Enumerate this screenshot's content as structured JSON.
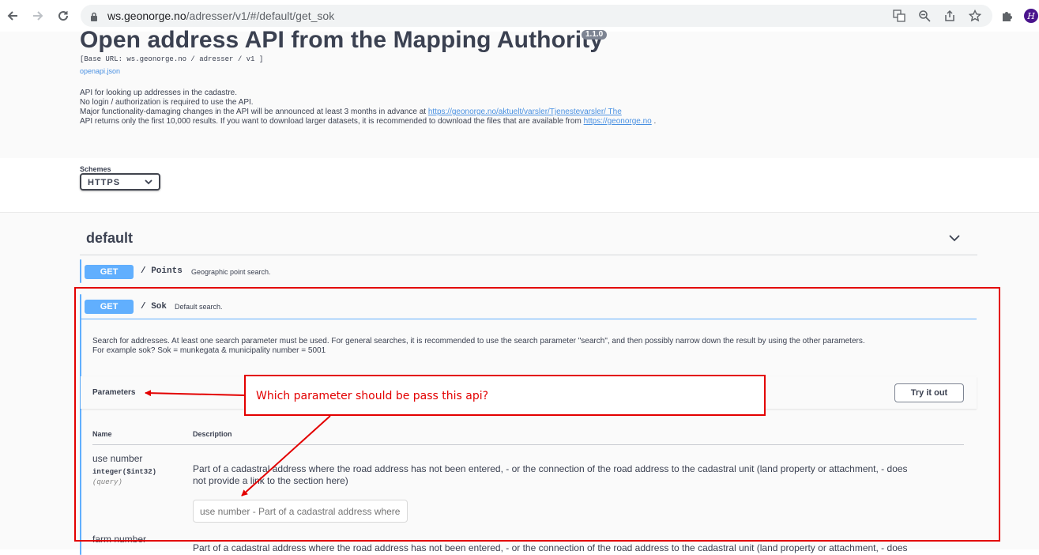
{
  "browser": {
    "url_host": "ws.geonorge.no",
    "url_path": "/adresser/v1/#/default/get_sok"
  },
  "info": {
    "title": "Open address API from the Mapping Authority",
    "version": "1.1.0",
    "base_url": "[Base URL: ws.geonorge.no / adresser / v1 ]",
    "openapi_link": "openapi.json",
    "desc_line1": "API for looking up addresses in the cadastre.",
    "desc_line2": "No login / authorization is required to use the API.",
    "desc_line3_text": "Major functionality-damaging changes in the API will be announced at least 3 months in advance at ",
    "desc_line3_link": "https://geonorge.no/aktuelt/varsler/Tjenestevarsler/ The",
    "desc_line4_text": "API returns only the first 10,000 results. If you want to download larger datasets, it is recommended to download the files that are available from ",
    "desc_line4_link": "https://geonorge.no",
    "desc_line4_end": " ."
  },
  "schemes": {
    "label": "Schemes",
    "selected": "HTTPS"
  },
  "tag": {
    "name": "default"
  },
  "operations": [
    {
      "method": "GET",
      "path": "/ Points",
      "summary": "Geographic point search."
    },
    {
      "method": "GET",
      "path": "/ Sok",
      "summary": "Default search."
    }
  ],
  "sok": {
    "desc_line1": "Search for addresses. At least one search parameter must be used. For general searches, it is recommended to use the search parameter \"search\", and then possibly narrow down the result by using the other parameters.",
    "desc_line2": "For example sok? Sok = munkegata & municipality number = 5001",
    "parameters_label": "Parameters",
    "try_button": "Try it out",
    "col_name": "Name",
    "col_description": "Description",
    "params": [
      {
        "name": "use number",
        "type": "integer($int32)",
        "in": "(query)",
        "desc_line1": "Part of a cadastral address where the road address has not been entered, - or the connection of the road address to the cadastral unit (land property or attachment, - does",
        "desc_line2": "not provide a link to the section here)",
        "placeholder": "use number - Part of a cadastral address where the road address has not been entered"
      },
      {
        "name": "farm number",
        "desc_line1": "Part of a cadastral address where the road address has not been entered, - or the connection of the road address to the cadastral unit (land property or attachment, - does"
      }
    ]
  },
  "annotation": {
    "note": "Which parameter should be pass this api?",
    "color": "#e30000"
  }
}
